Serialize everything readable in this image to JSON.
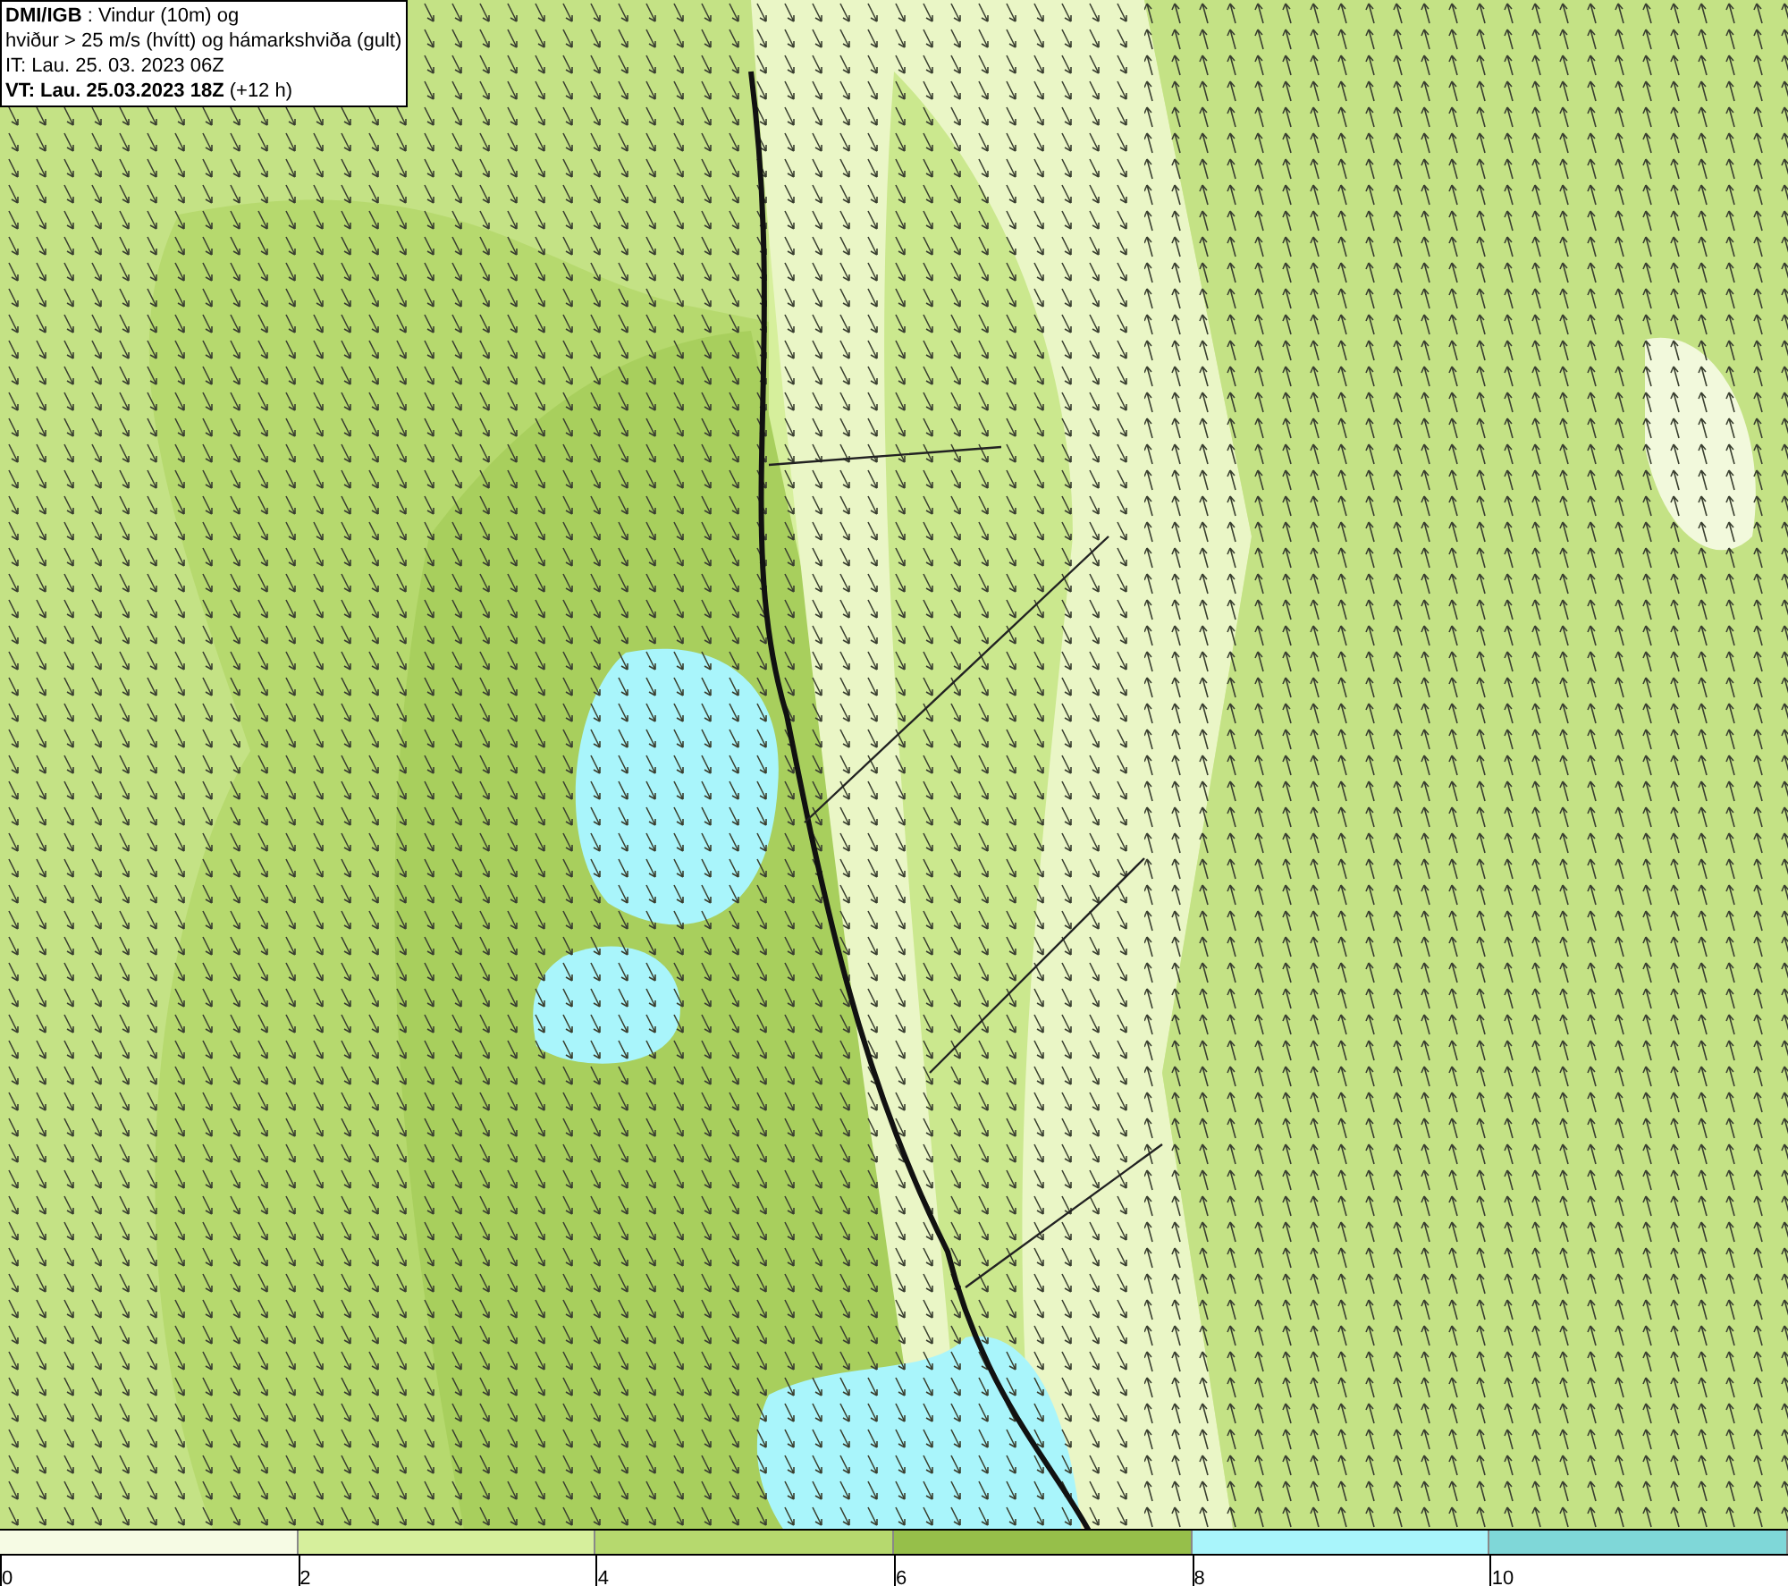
{
  "title_box": {
    "lines": [
      "**DMI/IGB** : Vindur (10m) og",
      "hviður > 25 m/s (hvítt) og hámarkshviða (gult)",
      "IT: Lau. 25. 03. 2023 06Z",
      "**VT: Lau. 25.03.2023 18Z** (+12 h)"
    ]
  },
  "legend": {
    "bins": [
      {
        "color": "#f6fbe4",
        "label": "0"
      },
      {
        "color": "#d6ef9c",
        "label": "2"
      },
      {
        "color": "#b6d96e",
        "label": "4"
      },
      {
        "color": "#96bf4a",
        "label": "6"
      },
      {
        "color": "#a9f5fb",
        "label": "8"
      },
      {
        "color": "#7fd7d8",
        "label": "10"
      }
    ]
  }
}
